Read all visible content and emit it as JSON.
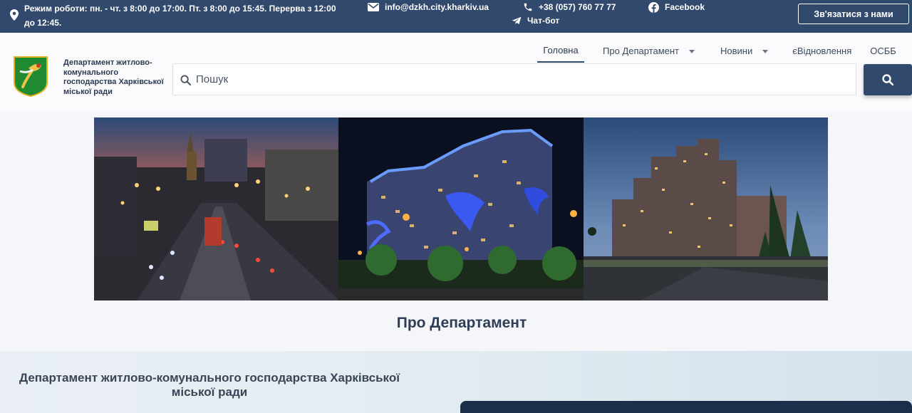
{
  "topbar": {
    "hours": "Режим роботи: пн. - чт. з 8:00 до 17:00. Пт. з 8:00 до 15:45. Перерва з 12:00 до 12:45.",
    "email": "info@dzkh.city.kharkiv.ua",
    "phone": "+38 (057) 760 77 77",
    "chatbot": "Чат-бот",
    "facebook": "Facebook",
    "contact_button": "Зв'язатися з нами"
  },
  "header": {
    "org_name": "Департамент житлово-комунального господарства Харківської міської ради",
    "nav": [
      {
        "label": "Головна",
        "active": true
      },
      {
        "label": "Про Департамент",
        "dropdown": true
      },
      {
        "label": "Новини",
        "dropdown": true
      },
      {
        "label": "єВідновлення"
      },
      {
        "label": "ОСББ"
      }
    ],
    "search": {
      "placeholder": "Пошук",
      "value": ""
    }
  },
  "hero": {
    "panels": [
      "city-street-at-dusk-photo",
      "illuminated-apartment-building-photo",
      "residential-towers-evening-photo"
    ]
  },
  "section": {
    "title": "Про Департамент",
    "about_heading": "Департамент житлово-комунального господарства Харківської міської ради"
  },
  "colors": {
    "topbar": "#32496e",
    "accent": "#32496e",
    "title": "#2f3e58"
  }
}
